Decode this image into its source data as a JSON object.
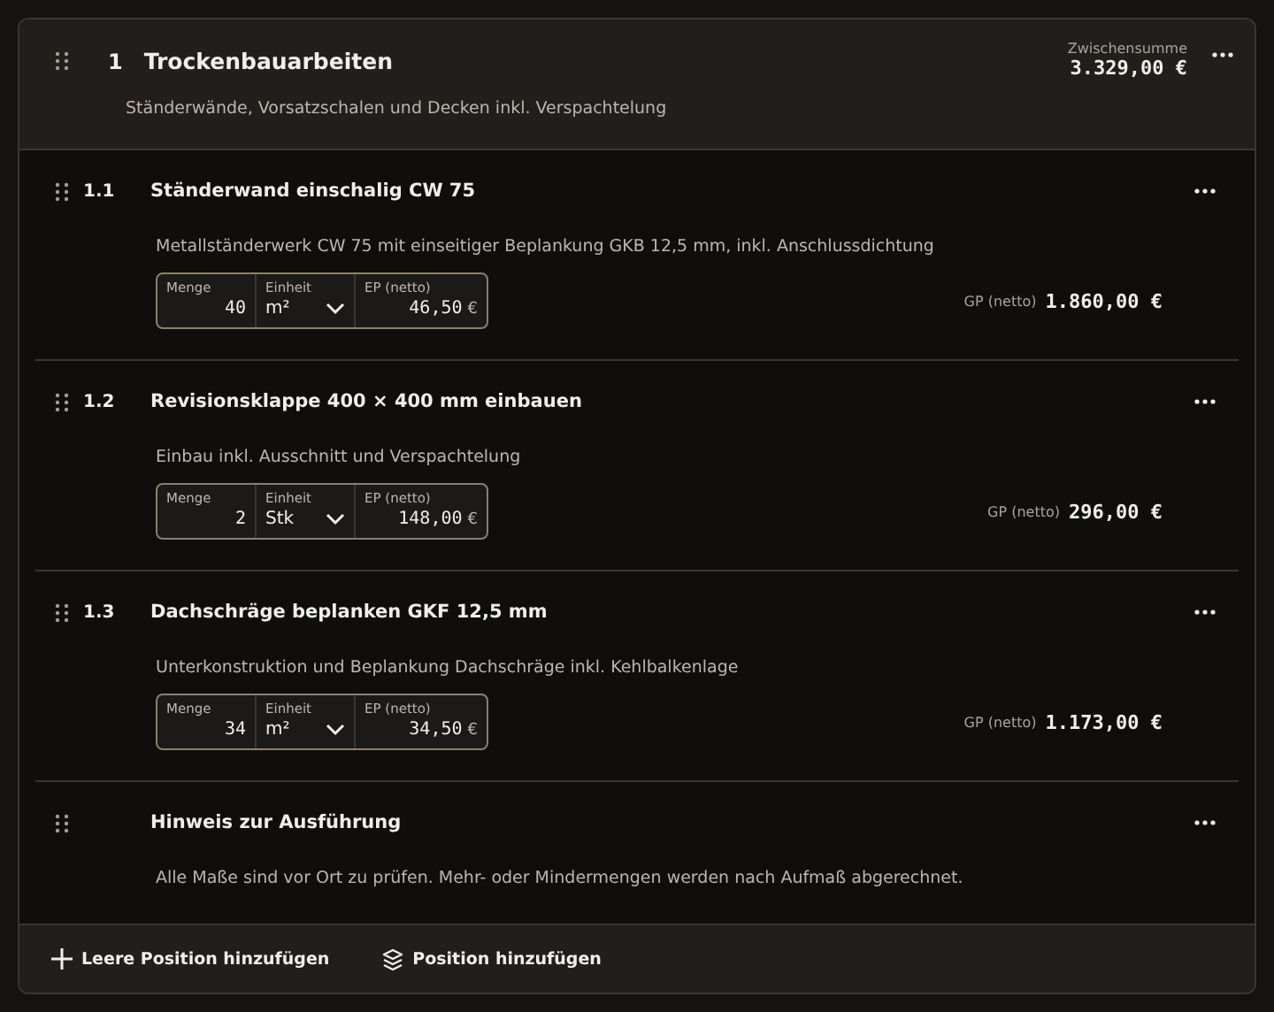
{
  "group": {
    "number": "1",
    "title": "Trockenbauarbeiten",
    "description": "Ständerwände, Vorsatzschalen und Decken inkl. Verspachtelung",
    "subtotal_label": "Zwischensumme",
    "subtotal": "3.329,00 €"
  },
  "items": [
    {
      "kind": "position",
      "number": "1.1",
      "title": "Ständerwand einschalig CW 75",
      "description": "Metallständerwerk CW 75 mit einseitiger Beplankung GKB 12,5 mm, inkl. Anschlussdichtung",
      "quantity_label": "Menge",
      "quantity": "40",
      "unit_label": "Einheit",
      "unit": "m²",
      "price_label": "EP (netto)",
      "price": "46,50",
      "currency": "€",
      "total_label": "GP (netto)",
      "total": "1.860,00 €"
    },
    {
      "kind": "position",
      "number": "1.2",
      "title": "Revisionsklappe 400 × 400 mm einbauen",
      "description": "Einbau inkl. Ausschnitt und Verspachtelung",
      "quantity_label": "Menge",
      "quantity": "2",
      "unit_label": "Einheit",
      "unit": "Stk",
      "price_label": "EP (netto)",
      "price": "148,00",
      "currency": "€",
      "total_label": "GP (netto)",
      "total": "296,00 €"
    },
    {
      "kind": "position",
      "number": "1.3",
      "title": "Dachschräge beplanken GKF 12,5 mm",
      "description": "Unterkonstruktion und Beplankung Dachschräge inkl. Kehlbalkenlage",
      "quantity_label": "Menge",
      "quantity": "34",
      "unit_label": "Einheit",
      "unit": "m²",
      "price_label": "EP (netto)",
      "price": "34,50",
      "currency": "€",
      "total_label": "GP (netto)",
      "total": "1.173,00 €"
    },
    {
      "kind": "note",
      "title": "Hinweis zur Ausführung",
      "description": "Alle Maße sind vor Ort zu prüfen. Mehr- oder Mindermengen werden nach Aufmaß abgerechnet."
    }
  ],
  "footer": {
    "actions": [
      {
        "kind": "empty",
        "label": "Leere Position hinzufügen"
      },
      {
        "kind": "catalog",
        "label": "Position hinzufügen"
      }
    ]
  }
}
